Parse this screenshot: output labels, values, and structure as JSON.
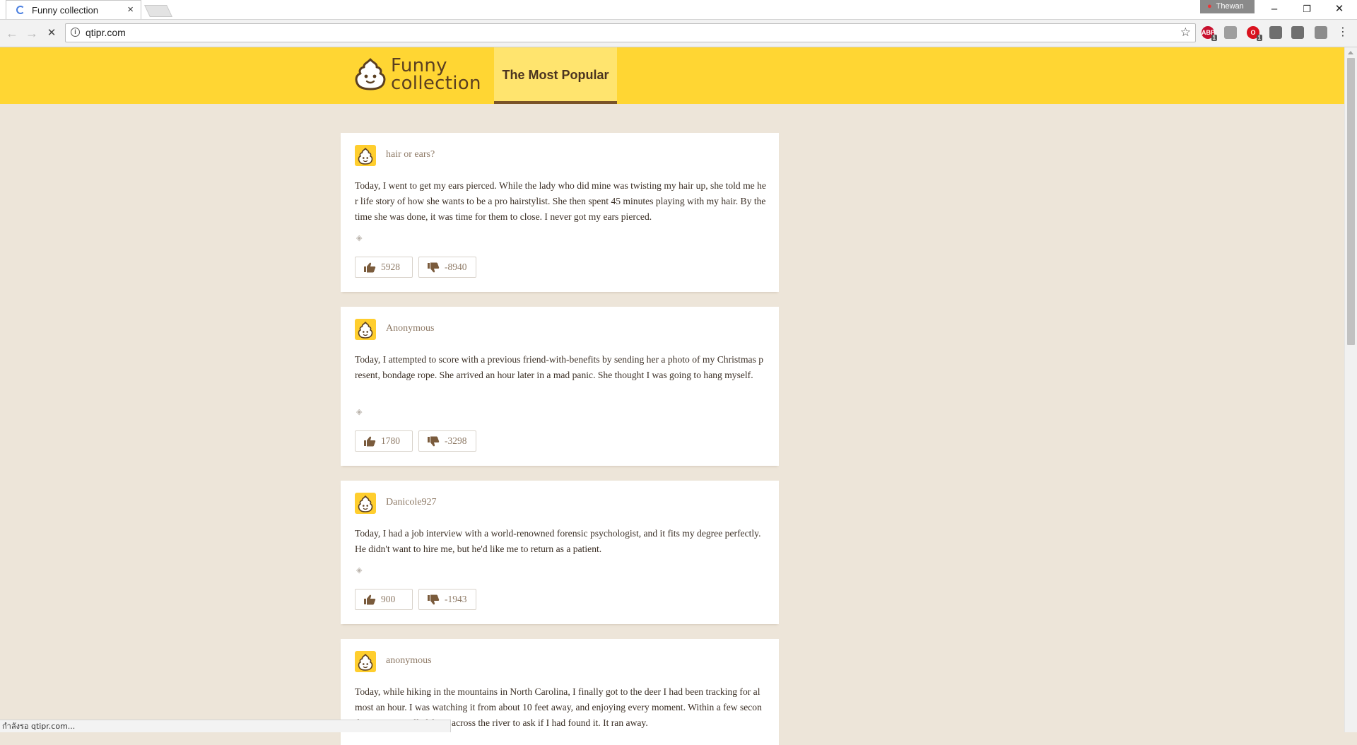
{
  "browser": {
    "tab_title": "Funny collection",
    "tab_close": "×",
    "url": "qtipr.com",
    "profile_name": "Thewan",
    "window_buttons": {
      "minimize": "–",
      "restore": "❐",
      "close": "✕"
    },
    "nav": {
      "back": "←",
      "forward": "→",
      "reload": "✕"
    },
    "bookmark_star": "☆",
    "extensions": [
      {
        "name": "adblock-icon",
        "label": "ABP",
        "color": "#c8102e",
        "badge": "1"
      },
      {
        "name": "extension-gray-icon",
        "label": "",
        "color": "#9e9e9e",
        "badge": ""
      },
      {
        "name": "opera-icon",
        "label": "O",
        "color": "#d9121e",
        "badge": "1"
      },
      {
        "name": "extension-cat-icon",
        "label": "",
        "color": "#6f6f6f",
        "badge": ""
      },
      {
        "name": "extension-briefcase-icon",
        "label": "",
        "color": "#6f6f6f",
        "badge": ""
      },
      {
        "name": "extension-person-icon",
        "label": "",
        "color": "#8c8c8c",
        "badge": ""
      }
    ],
    "menu": "⋮",
    "status_text": "กำลังรอ qtipr.com..."
  },
  "site": {
    "logo_line1": "Funny",
    "logo_line2": "collection",
    "nav_popular": "The Most Popular",
    "accent": "#ffd633",
    "active_nav_bg": "#ffe46e"
  },
  "posts": [
    {
      "author": "hair or ears?",
      "text": "Today, I went to get my ears pierced. While the lady who did mine was twisting my hair up, she told me her life story of how she wants to be a pro hairstylist. She then spent 45 minutes playing with my hair. By the time she was done, it was time for them to close. I never got my ears pierced.",
      "likes": "5928",
      "dislikes": "-8940"
    },
    {
      "author": "Anonymous",
      "text": "Today, I attempted to score with a previous friend-with-benefits by sending her a photo of my Christmas present, bondage rope. She arrived an hour later in a mad panic. She thought I was going to hang myself.",
      "likes": "1780",
      "dislikes": "-3298"
    },
    {
      "author": "Danicole927",
      "text": "Today, I had a job interview with a world-renowned forensic psychologist, and it fits my degree perfectly. He didn't want to hire me, but he'd like me to return as a patient.",
      "likes": "900",
      "dislikes": "-1943"
    },
    {
      "author": "anonymous",
      "text": "Today, while hiking in the mountains in North Carolina, I finally got to the deer I had been tracking for almost an hour. I was watching it from about 10 feet away, and enjoying every moment. Within a few seconds, someone yelled from across the river to ask if I had found it. It ran away.",
      "likes": "",
      "dislikes": ""
    }
  ]
}
